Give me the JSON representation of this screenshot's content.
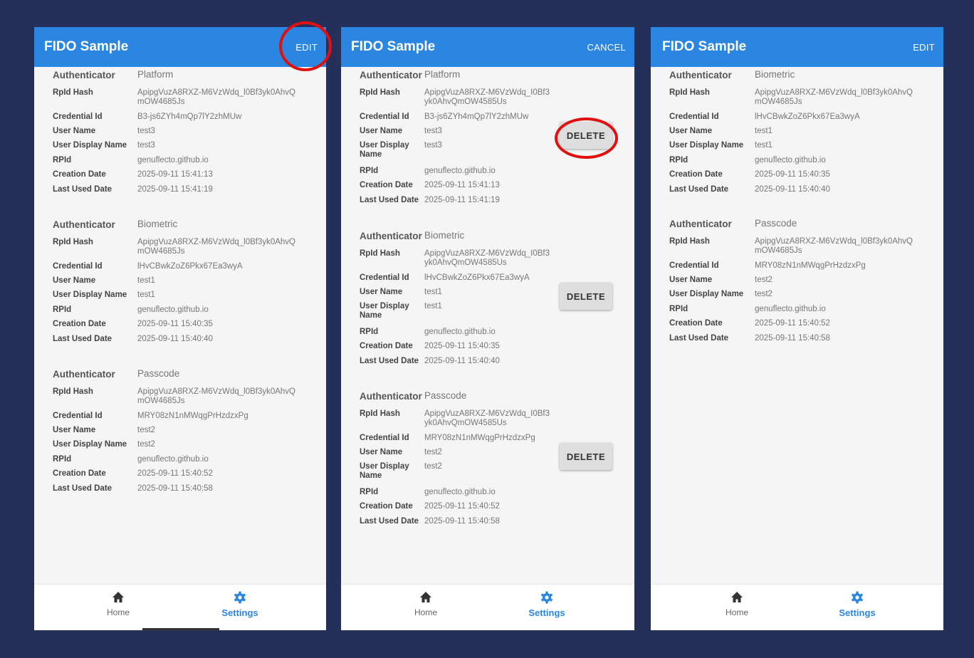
{
  "appbar": {
    "title": "FIDO Sample",
    "edit_label": "EDIT",
    "cancel_label": "CANCEL"
  },
  "labels": {
    "authenticator": "Authenticator",
    "rpid_hash": "RpId Hash",
    "credential_id": "Credential Id",
    "user_name": "User Name",
    "user_display_name": "User Display Name",
    "user_display_line1": "User Display",
    "user_display_line2": "Name",
    "rpid": "RPId",
    "creation_date": "Creation Date",
    "last_used_date": "Last Used Date"
  },
  "credentials": [
    {
      "authenticator": "Platform",
      "rpid_hash_1": "ApipgVuzA8RXZ-M6VzWdq_l0Bf3yk0AhvQ",
      "rpid_hash_2": "mOW4685Js",
      "credential_id": "B3-js6ZYh4mQp7lY2zhMUw",
      "user_name": "test3",
      "user_display_name": "test3",
      "rpid": "genuflecto.github.io",
      "creation_date": "2025-09-11 15:41:13",
      "last_used_date": "2025-09-11 15:41:19"
    },
    {
      "authenticator": "Biometric",
      "rpid_hash_1": "ApipgVuzA8RXZ-M6VzWdq_l0Bf3yk0AhvQ",
      "rpid_hash_2": "mOW4685Js",
      "credential_id": "lHvCBwkZoZ6Pkx67Ea3wyA",
      "user_name": "test1",
      "user_display_name": "test1",
      "rpid": "genuflecto.github.io",
      "creation_date": "2025-09-11 15:40:35",
      "last_used_date": "2025-09-11 15:40:40"
    },
    {
      "authenticator": "Passcode",
      "rpid_hash_1": "ApipgVuzA8RXZ-M6VzWdq_l0Bf3yk0AhvQ",
      "rpid_hash_2": "mOW4685Js",
      "credential_id": "MRY08zN1nMWqgPrHzdzxPg",
      "user_name": "test2",
      "user_display_name": "test2",
      "rpid": "genuflecto.github.io",
      "creation_date": "2025-09-11 15:40:52",
      "last_used_date": "2025-09-11 15:40:58"
    }
  ],
  "edit_mode_hash": {
    "line1": "ApipgVuzA8RXZ-M6VzWdq_I0Bf3",
    "line2": "yk0AhvQmOW4585Us"
  },
  "delete_label": "DELETE",
  "nav": {
    "home_label": "Home",
    "settings_label": "Settings"
  },
  "colors": {
    "background": "#24305a",
    "appbar": "#2a86e0",
    "highlight": "#e01010",
    "active_tab": "#2a86e0"
  },
  "icons": [
    "home-icon",
    "gear-icon"
  ]
}
